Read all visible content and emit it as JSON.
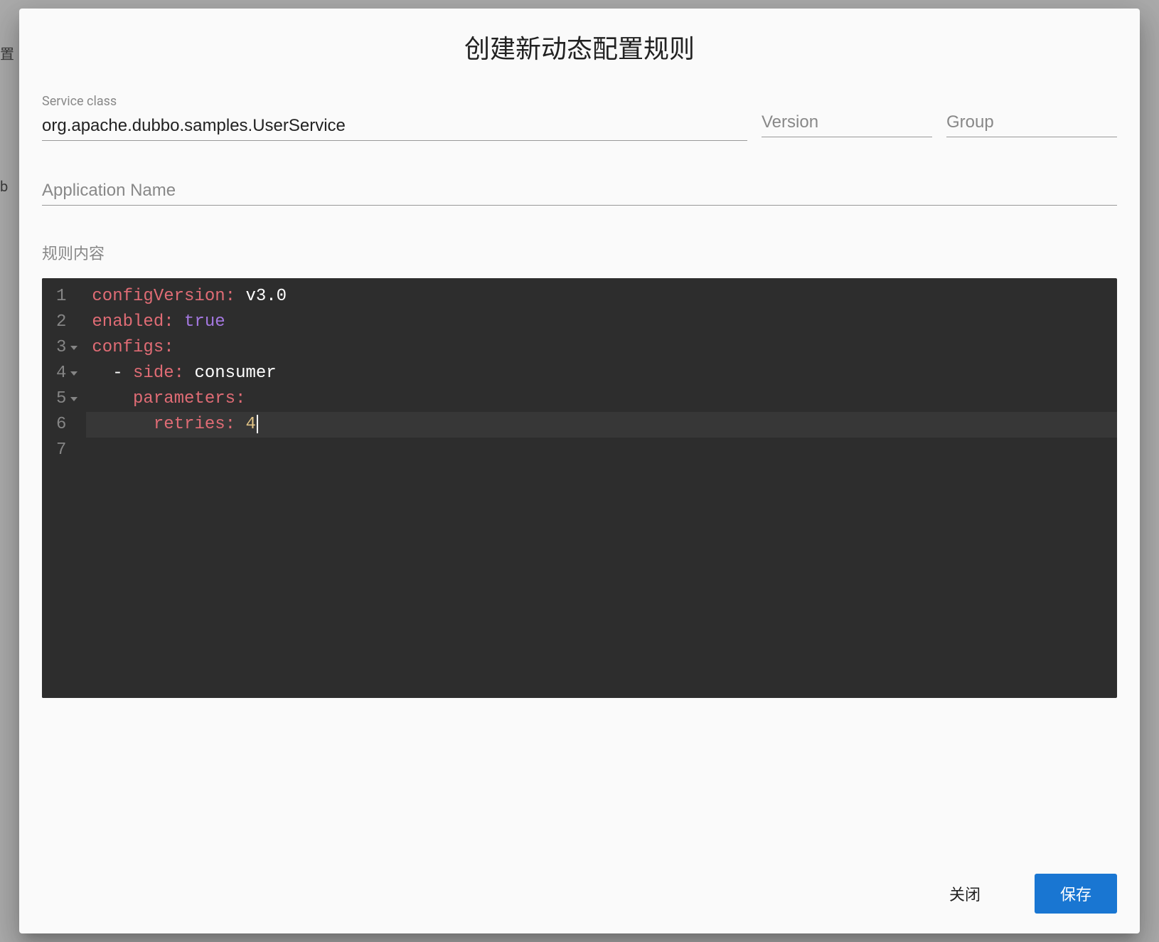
{
  "dialog": {
    "title": "创建新动态配置规则",
    "fields": {
      "service_class": {
        "label": "Service class",
        "value": "org.apache.dubbo.samples.UserService"
      },
      "version": {
        "placeholder": "Version",
        "value": ""
      },
      "group": {
        "placeholder": "Group",
        "value": ""
      },
      "application_name": {
        "placeholder": "Application Name",
        "value": ""
      }
    },
    "rule_content_label": "规则内容",
    "code": {
      "lines": [
        {
          "num": "1",
          "fold": false,
          "tokens": [
            {
              "t": "key",
              "v": "configVersion:"
            },
            {
              "t": "sp",
              "v": " "
            },
            {
              "t": "value",
              "v": "v3.0"
            }
          ]
        },
        {
          "num": "2",
          "fold": false,
          "tokens": [
            {
              "t": "key",
              "v": "enabled:"
            },
            {
              "t": "sp",
              "v": " "
            },
            {
              "t": "bool",
              "v": "true"
            }
          ]
        },
        {
          "num": "3",
          "fold": true,
          "tokens": [
            {
              "t": "key",
              "v": "configs:"
            }
          ]
        },
        {
          "num": "4",
          "fold": true,
          "tokens": [
            {
              "t": "sp",
              "v": "  "
            },
            {
              "t": "dash",
              "v": "-"
            },
            {
              "t": "sp",
              "v": " "
            },
            {
              "t": "key",
              "v": "side:"
            },
            {
              "t": "sp",
              "v": " "
            },
            {
              "t": "value",
              "v": "consumer"
            }
          ]
        },
        {
          "num": "5",
          "fold": true,
          "tokens": [
            {
              "t": "sp",
              "v": "    "
            },
            {
              "t": "key",
              "v": "parameters:"
            }
          ]
        },
        {
          "num": "6",
          "fold": false,
          "active": true,
          "tokens": [
            {
              "t": "sp",
              "v": "      "
            },
            {
              "t": "key",
              "v": "retries:"
            },
            {
              "t": "sp",
              "v": " "
            },
            {
              "t": "num",
              "v": "4"
            }
          ],
          "cursor": true
        },
        {
          "num": "7",
          "fold": false,
          "tokens": []
        }
      ]
    },
    "actions": {
      "close": "关闭",
      "save": "保存"
    }
  }
}
